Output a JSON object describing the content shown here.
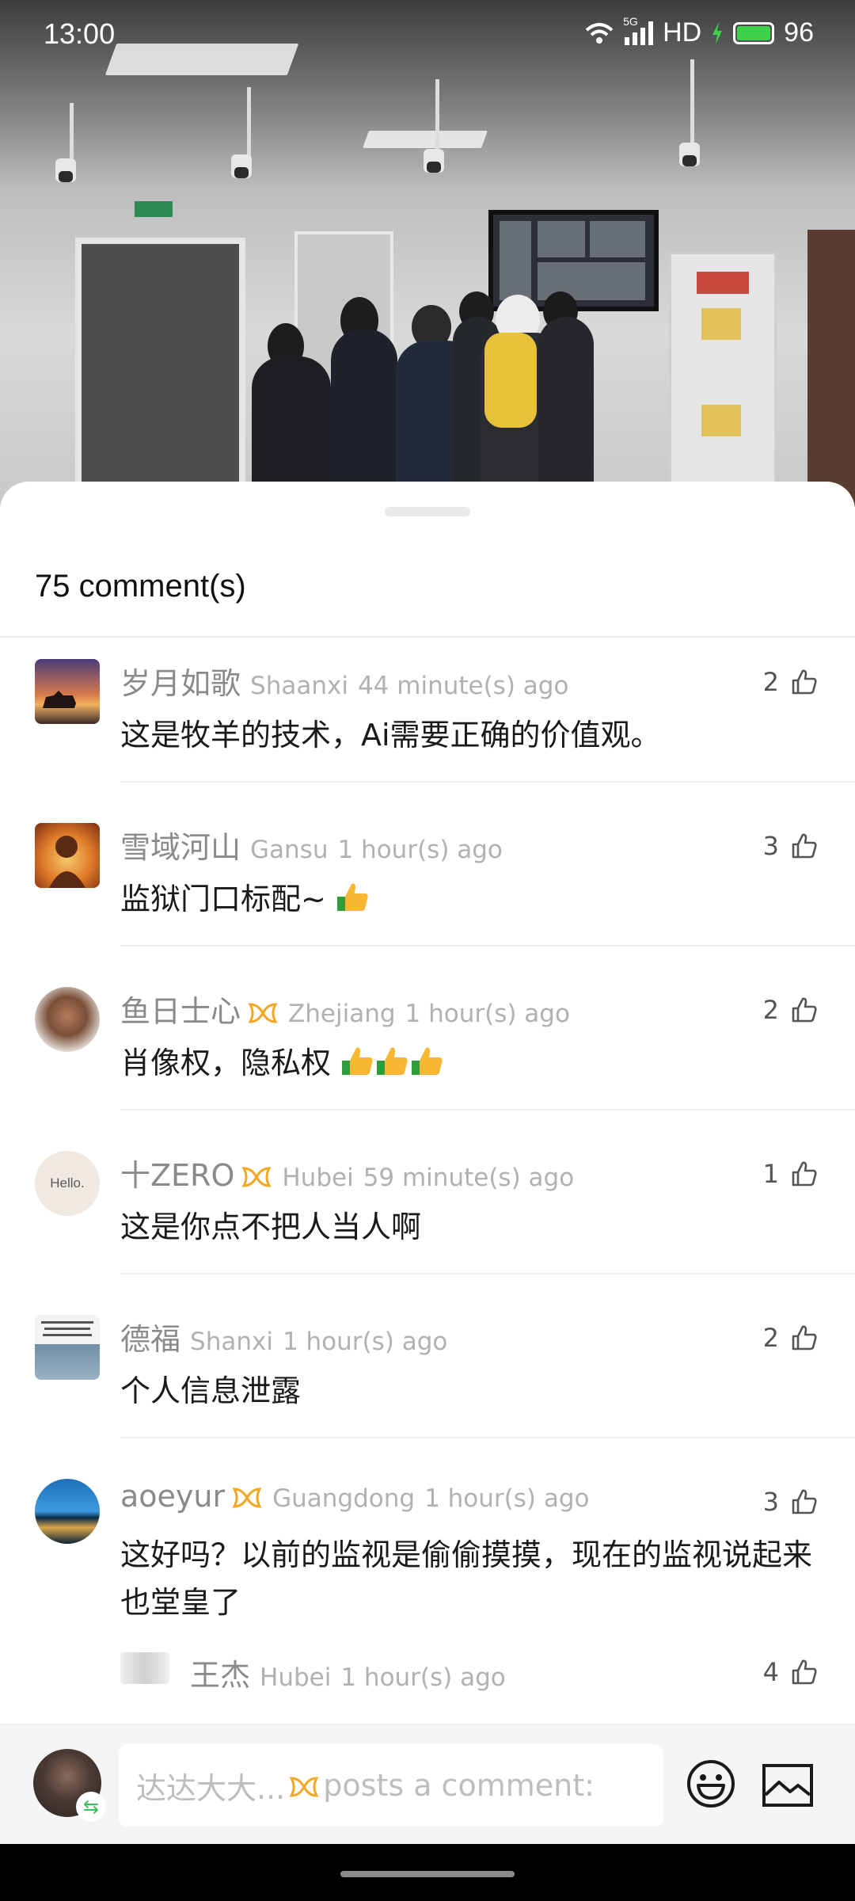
{
  "status_bar": {
    "time": "13:00",
    "network": "5G",
    "hd": "HD",
    "battery": "96"
  },
  "comments_header": {
    "count_label": "75 comment(s)"
  },
  "comments": [
    {
      "name": "岁月如歌",
      "region": "Shaanxi",
      "time": "44 minute(s) ago",
      "text": "这是牧羊的技术，Ai需要正确的价值观。",
      "likes": "2",
      "badge": false
    },
    {
      "name": "雪域河山",
      "region": "Gansu",
      "time": "1 hour(s) ago",
      "text": "监狱门口标配~",
      "emoji_count": 1,
      "likes": "3",
      "badge": false
    },
    {
      "name": "鱼日士心",
      "region": "Zhejiang",
      "time": "1 hour(s) ago",
      "text": "肖像权，隐私权",
      "emoji_count": 3,
      "likes": "2",
      "badge": true
    },
    {
      "name": "十ZERO",
      "region": "Hubei",
      "time": "59 minute(s) ago",
      "text": "这是你点不把人当人啊",
      "likes": "1",
      "badge": true,
      "avatar_text": "Hello."
    },
    {
      "name": "德福",
      "region": "Shanxi",
      "time": "1 hour(s) ago",
      "text": "个人信息泄露",
      "likes": "2",
      "badge": false
    },
    {
      "name": "aoeyur",
      "region": "Guangdong",
      "time": "1 hour(s) ago",
      "text": "这好吗？以前的监视是偷偷摸摸，现在的监视说起来也堂皇了",
      "likes": "3",
      "badge": true
    }
  ],
  "reply": {
    "name": "王杰",
    "region": "Hubei",
    "time": "1 hour(s) ago",
    "likes": "4"
  },
  "input_bar": {
    "placeholder_user": "达达大大...",
    "placeholder_suffix": "posts a comment:"
  },
  "icons": {
    "like": "thumbs-up-outline-icon",
    "badge": "vip-badge-icon",
    "emoji_button": "smiley-icon",
    "image_button": "image-icon"
  },
  "colors": {
    "badge": "#f5a623",
    "name": "#8a8a8a",
    "meta": "#b1b1b1",
    "battery": "#3fd14a"
  }
}
